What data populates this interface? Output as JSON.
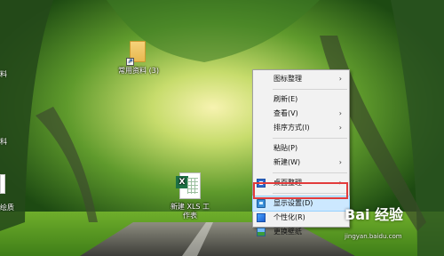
{
  "desktop": {
    "icons": {
      "folder_label": "常用资料 (3)",
      "xls_label_line1": "新建 XLS 工",
      "xls_label_line2": "作表"
    },
    "edge_labels": [
      "料",
      "科",
      "绘质"
    ]
  },
  "context_menu": {
    "items": [
      {
        "label": "图标整理",
        "submenu": true
      },
      {
        "label": "刷新(E)",
        "submenu": false
      },
      {
        "label": "查看(V)",
        "submenu": true
      },
      {
        "label": "排序方式(I)",
        "submenu": true
      },
      {
        "label": "粘贴(P)",
        "submenu": false
      },
      {
        "label": "新建(W)",
        "submenu": true
      },
      {
        "label": "桌面整理",
        "submenu": true,
        "icon": "desktop-organize-icon"
      },
      {
        "label": "显示设置(D)",
        "submenu": false,
        "icon": "display-settings-icon",
        "highlighted": true
      },
      {
        "label": "个性化(R)",
        "submenu": false,
        "icon": "personalize-icon"
      },
      {
        "label": "更换壁纸",
        "submenu": false,
        "icon": "wallpaper-icon"
      }
    ],
    "arrow_glyph": "›",
    "highlight_color": "#cce8ff",
    "annotation_color": "#e23b3b"
  },
  "watermark": {
    "brand": "Bai 经验",
    "url": "jingyan.baidu.com"
  }
}
